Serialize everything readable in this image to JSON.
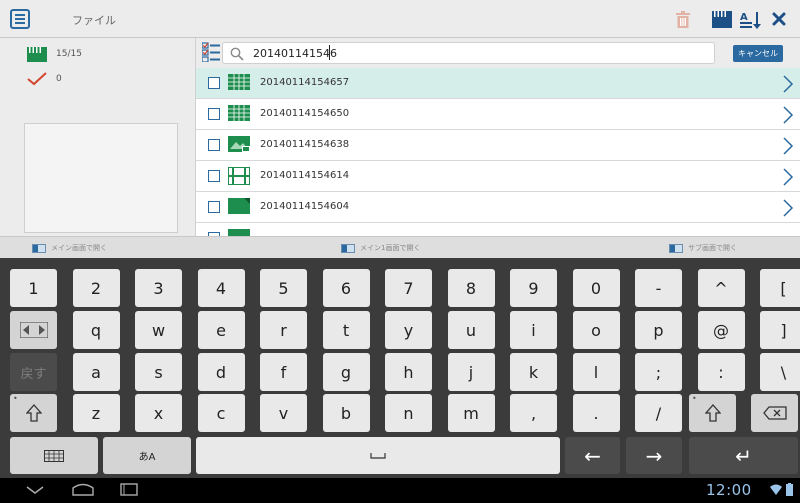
{
  "header": {
    "title": "ファイル"
  },
  "sidebar": {
    "file_count": "15/15",
    "checked_count": "0"
  },
  "search": {
    "value": "201401141546",
    "cancel_label": "キャンセル"
  },
  "files": [
    {
      "name": "20140114154657",
      "selected": true
    },
    {
      "name": "20140114154650",
      "selected": false
    },
    {
      "name": "20140114154638",
      "selected": false
    },
    {
      "name": "20140114154614",
      "selected": false
    },
    {
      "name": "20140114154604",
      "selected": false
    }
  ],
  "open_bar": {
    "main": "メイン画面で開く",
    "main1": "メイン1画面で開く",
    "sub": "サブ画面で開く"
  },
  "keyboard": {
    "row1": [
      "1",
      "2",
      "3",
      "4",
      "5",
      "6",
      "7",
      "8",
      "9",
      "0",
      "-",
      "^",
      "["
    ],
    "row2": [
      "q",
      "w",
      "e",
      "r",
      "t",
      "y",
      "u",
      "i",
      "o",
      "p",
      "@",
      "]"
    ],
    "row3": [
      "a",
      "s",
      "d",
      "f",
      "g",
      "h",
      "j",
      "k",
      "l",
      ";",
      ":",
      "\\"
    ],
    "row4": [
      "z",
      "x",
      "c",
      "v",
      "b",
      "n",
      "m",
      ",",
      ".",
      "/"
    ],
    "back_label": "戻す",
    "ime_label": "あA",
    "enter_symbol": "↵",
    "left_arrow": "←",
    "right_arrow": "→"
  },
  "status": {
    "time": "12:00"
  },
  "colors": {
    "accent": "#2a6aa0",
    "green": "#1e8e4e",
    "selected_row": "#d6eee9",
    "clock": "#9ac4ea"
  }
}
